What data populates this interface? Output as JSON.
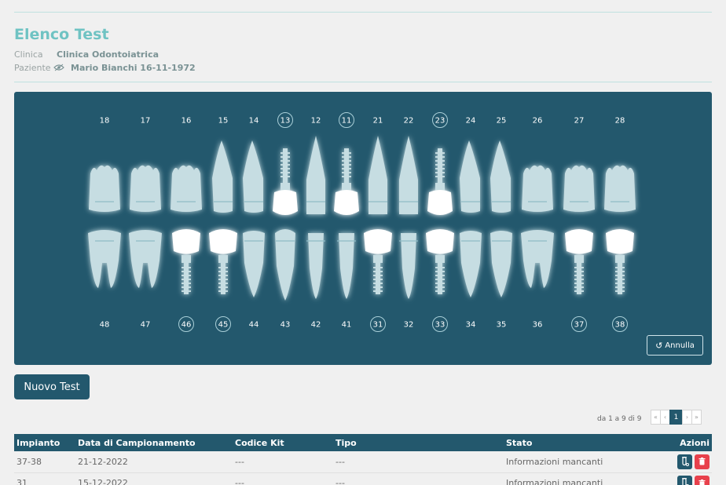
{
  "page": {
    "title": "Elenco Test"
  },
  "meta": {
    "clinica_label": "Clinica",
    "clinica_value": "Clinica Odontoiatrica",
    "paziente_label": "Paziente",
    "paziente_value": "Mario Bianchi 16-11-1972"
  },
  "chart": {
    "upper_numbers": [
      "18",
      "17",
      "16",
      "15",
      "14",
      "13",
      "12",
      "11",
      "21",
      "22",
      "23",
      "24",
      "25",
      "26",
      "27",
      "28"
    ],
    "lower_numbers": [
      "48",
      "47",
      "46",
      "45",
      "44",
      "43",
      "42",
      "41",
      "31",
      "32",
      "33",
      "34",
      "35",
      "36",
      "37",
      "38"
    ],
    "upper_circled": [
      "13",
      "11",
      "23"
    ],
    "lower_circled": [
      "46",
      "45",
      "31",
      "33",
      "37",
      "38"
    ],
    "upper_implants": [
      "13",
      "11",
      "23"
    ],
    "lower_implants": [
      "46",
      "45",
      "31",
      "33",
      "37",
      "38"
    ],
    "annulla_label": "Annulla"
  },
  "actions": {
    "nuovo_test_label": "Nuovo Test"
  },
  "pagination": {
    "info": "da 1 a 9 di 9",
    "first": "«",
    "prev": "‹",
    "current": "1",
    "next": "›",
    "last": "»"
  },
  "table": {
    "headers": [
      "Impianto",
      "Data di Campionamento",
      "Codice Kit",
      "Tipo",
      "Stato",
      "Azioni"
    ],
    "rows": [
      [
        "37-38",
        "21-12-2022",
        "---",
        "---",
        "Informazioni mancanti"
      ],
      [
        "31",
        "15-12-2022",
        "---",
        "---",
        "Informazioni mancanti"
      ]
    ]
  },
  "colors": {
    "primary": "#23586d",
    "accent": "#6fc3c3",
    "danger": "#e8414c",
    "tooth": "#c6dde2",
    "implant": "#ffffff"
  }
}
